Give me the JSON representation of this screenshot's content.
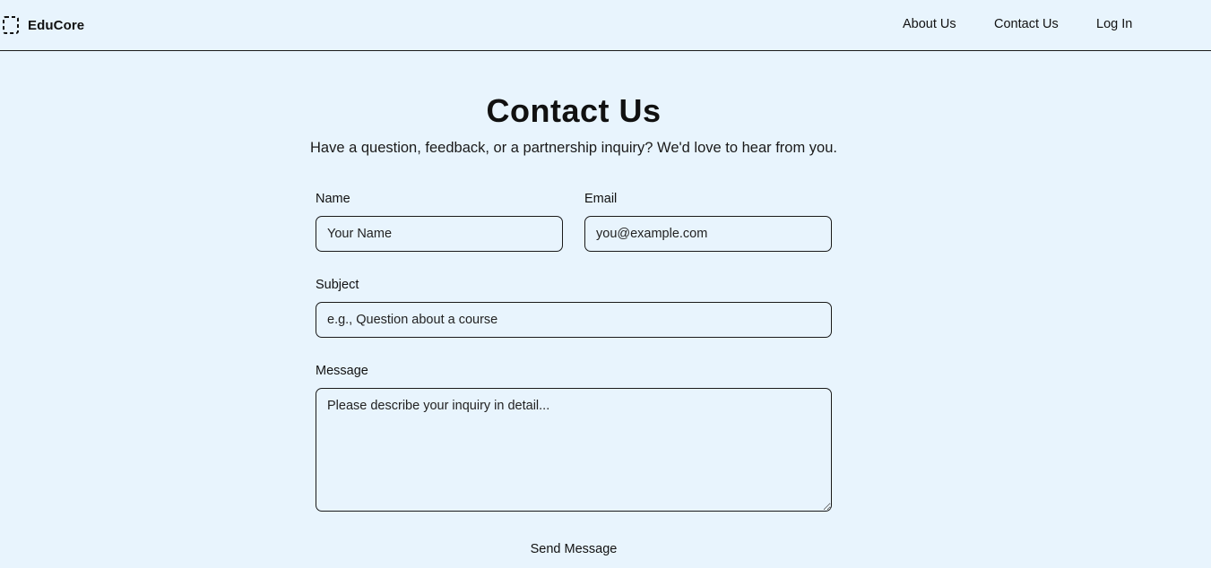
{
  "brand": {
    "name": "EduCore",
    "icon": "dashed-square-logo-icon"
  },
  "nav": {
    "about": "About Us",
    "contact": "Contact Us",
    "login": "Log In"
  },
  "page": {
    "title": "Contact Us",
    "subtitle": "Have a question, feedback, or a partnership inquiry? We'd love to hear from you."
  },
  "form": {
    "name": {
      "label": "Name",
      "placeholder": "Your Name",
      "value": ""
    },
    "email": {
      "label": "Email",
      "placeholder": "you@example.com",
      "value": ""
    },
    "subject": {
      "label": "Subject",
      "placeholder": "e.g., Question about a course",
      "value": ""
    },
    "message": {
      "label": "Message",
      "placeholder": "Please describe your inquiry in detail...",
      "value": ""
    },
    "submit_label": "Send Message"
  },
  "colors": {
    "background": "#e8f4fd",
    "text": "#111111",
    "border": "#1a1a1a"
  }
}
